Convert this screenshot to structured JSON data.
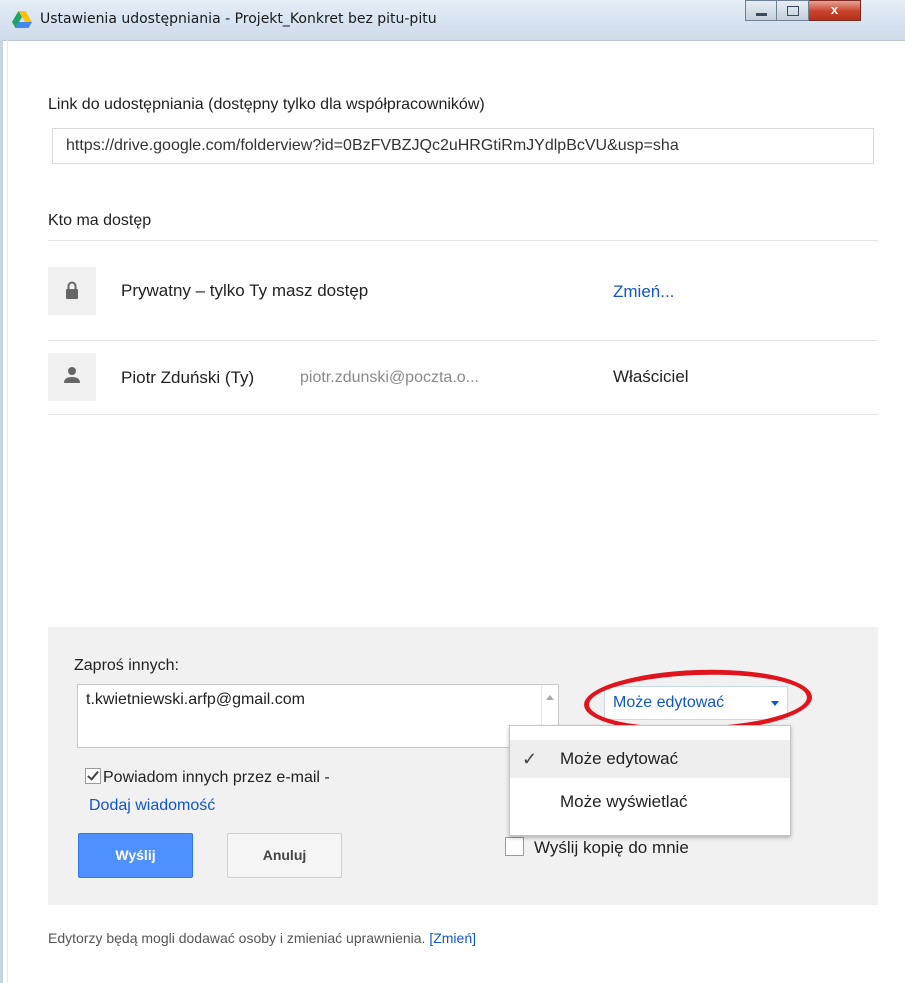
{
  "window": {
    "title": "Ustawienia udostępniania - Projekt_Konkret bez pitu-pitu",
    "close_glyph": "x"
  },
  "link_section": {
    "heading": "Link do udostępniania (dostępny tylko dla współpracowników)",
    "url": "https://drive.google.com/folderview?id=0BzFVBZJQc2uHRGtiRmJYdlpBcVU&usp=sha"
  },
  "access": {
    "heading": "Kto ma dostęp",
    "rows": [
      {
        "icon": "lock-icon",
        "name": "Prywatny – tylko Ty masz dostęp",
        "action": "Zmień..."
      },
      {
        "icon": "person-icon",
        "name": "Piotr Zduński (Ty)",
        "email": "piotr.zdunski@poczta.o...",
        "role": "Właściciel"
      }
    ]
  },
  "invite": {
    "label": "Zaproś innych:",
    "input_value": "t.kwietniewski.arfp@gmail.com",
    "permission": "Może edytować",
    "notify_label": "Powiadom innych przez e-mail -",
    "notify_checked": true,
    "add_message": "Dodaj wiadomość",
    "send": "Wyślij",
    "cancel": "Anuluj",
    "copy_label": "Wyślij kopię do mnie",
    "copy_checked": false
  },
  "menu": {
    "items": [
      {
        "label": "Może edytować",
        "selected": true,
        "check": "✓"
      },
      {
        "label": "Może wyświetlać",
        "selected": false
      }
    ]
  },
  "footer": {
    "text": "Edytorzy będą mogli dodawać osoby i zmieniać uprawnienia.",
    "link": "[Zmień]"
  },
  "colors": {
    "link": "#1155cc",
    "send_button": "#4d90fe",
    "annotation_oval": "#e0141d",
    "panel_bg": "#f1f1f1"
  }
}
